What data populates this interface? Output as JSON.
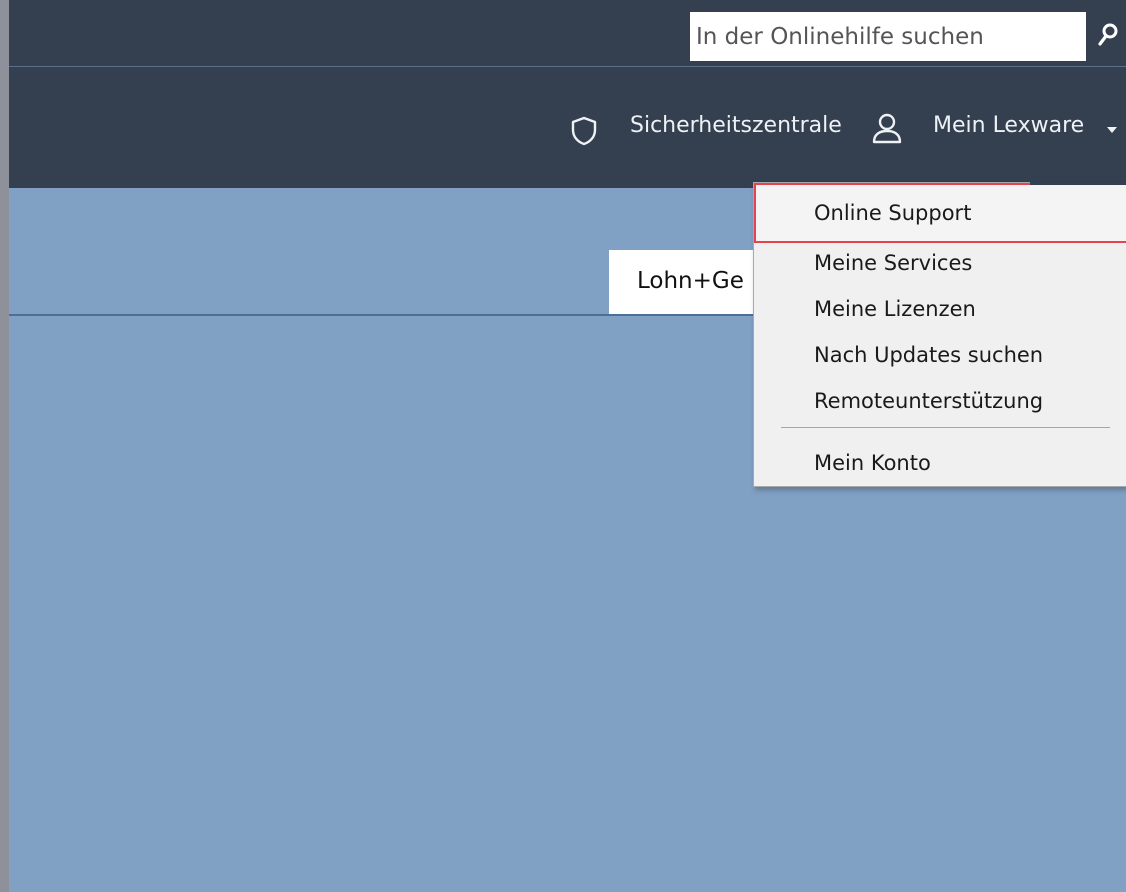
{
  "search": {
    "placeholder": "In der Onlinehilfe suchen"
  },
  "header": {
    "security_label": "Sicherheitszentrale",
    "account_label": "Mein Lexware"
  },
  "tab": {
    "label": "Lohn+Ge"
  },
  "menu": {
    "items": [
      {
        "label": "Online Support",
        "highlighted": true
      },
      {
        "label": "Meine Services"
      },
      {
        "label": "Meine Lizenzen"
      },
      {
        "label": "Nach Updates suchen"
      },
      {
        "label": "Remoteunterstützung"
      },
      {
        "label": "Mein Konto"
      }
    ]
  },
  "colors": {
    "header_bg": "#34404f",
    "content_bg": "#80a0c4",
    "highlight_border": "#e8434d",
    "menu_bg": "#f0f0f0"
  },
  "icons": {
    "search": "search-icon",
    "security": "shield-icon",
    "account": "user-icon",
    "dropdown": "chevron-down-icon"
  }
}
